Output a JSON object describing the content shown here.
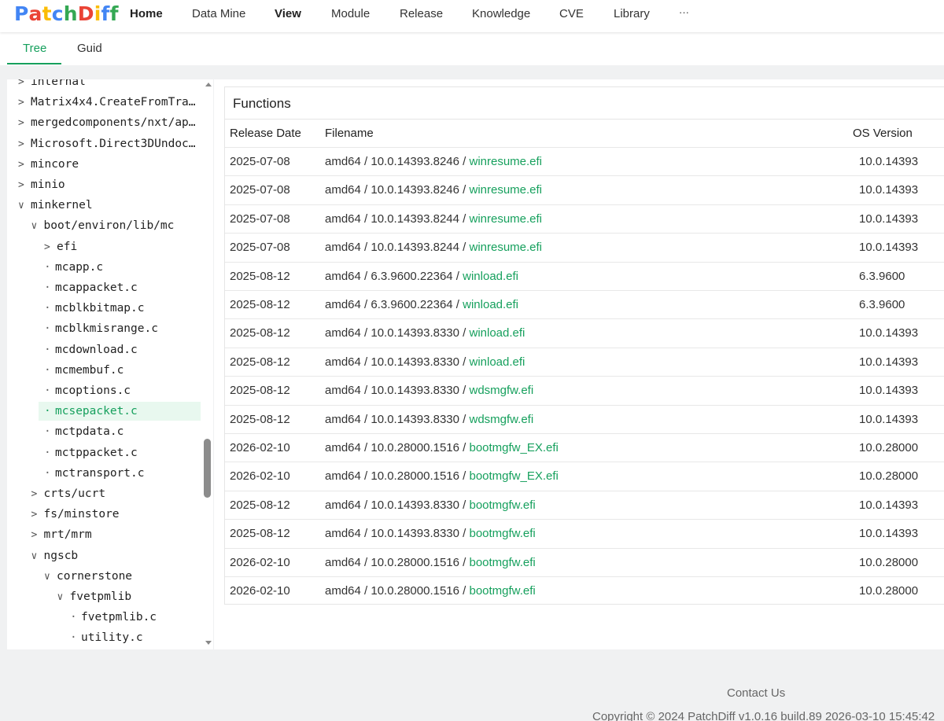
{
  "brand": {
    "letters": [
      {
        "char": "P",
        "color": "#4285F4"
      },
      {
        "char": "a",
        "color": "#EA4335"
      },
      {
        "char": "t",
        "color": "#FBBC05"
      },
      {
        "char": "c",
        "color": "#4285F4"
      },
      {
        "char": "h",
        "color": "#34A853"
      },
      {
        "char": "D",
        "color": "#EA4335"
      },
      {
        "char": "i",
        "color": "#FBBC05"
      },
      {
        "char": "f",
        "color": "#4285F4"
      },
      {
        "char": "f",
        "color": "#34A853"
      }
    ]
  },
  "nav": {
    "home": "Home",
    "data_mine": "Data Mine",
    "view": "View",
    "module": "Module",
    "release": "Release",
    "knowledge": "Knowledge",
    "cve": "CVE",
    "library": "Library",
    "more": "···"
  },
  "tabs": {
    "tree": "Tree",
    "guid": "Guid"
  },
  "accent_color": "#16a05d",
  "tree": [
    {
      "label": "internal",
      "type": "folder",
      "expanded": false,
      "depth": 0
    },
    {
      "label": "Matrix4x4.CreateFromTra…",
      "type": "folder",
      "expanded": false,
      "depth": 0
    },
    {
      "label": "mergedcomponents/nxt/ap…",
      "type": "folder",
      "expanded": false,
      "depth": 0
    },
    {
      "label": "Microsoft.Direct3DUndoc…",
      "type": "folder",
      "expanded": false,
      "depth": 0
    },
    {
      "label": "mincore",
      "type": "folder",
      "expanded": false,
      "depth": 0
    },
    {
      "label": "minio",
      "type": "folder",
      "expanded": false,
      "depth": 0
    },
    {
      "label": "minkernel",
      "type": "folder",
      "expanded": true,
      "depth": 0
    },
    {
      "label": "boot/environ/lib/mc",
      "type": "folder",
      "expanded": true,
      "depth": 1
    },
    {
      "label": "efi",
      "type": "folder",
      "expanded": false,
      "depth": 2
    },
    {
      "label": "mcapp.c",
      "type": "file",
      "depth": 2
    },
    {
      "label": "mcappacket.c",
      "type": "file",
      "depth": 2
    },
    {
      "label": "mcblkbitmap.c",
      "type": "file",
      "depth": 2
    },
    {
      "label": "mcblkmisrange.c",
      "type": "file",
      "depth": 2
    },
    {
      "label": "mcdownload.c",
      "type": "file",
      "depth": 2
    },
    {
      "label": "mcmembuf.c",
      "type": "file",
      "depth": 2
    },
    {
      "label": "mcoptions.c",
      "type": "file",
      "depth": 2
    },
    {
      "label": "mcsepacket.c",
      "type": "file",
      "depth": 2,
      "selected": true
    },
    {
      "label": "mctpdata.c",
      "type": "file",
      "depth": 2
    },
    {
      "label": "mctppacket.c",
      "type": "file",
      "depth": 2
    },
    {
      "label": "mctransport.c",
      "type": "file",
      "depth": 2
    },
    {
      "label": "crts/ucrt",
      "type": "folder",
      "expanded": false,
      "depth": 1
    },
    {
      "label": "fs/minstore",
      "type": "folder",
      "expanded": false,
      "depth": 1
    },
    {
      "label": "mrt/mrm",
      "type": "folder",
      "expanded": false,
      "depth": 1
    },
    {
      "label": "ngscb",
      "type": "folder",
      "expanded": true,
      "depth": 1
    },
    {
      "label": "cornerstone",
      "type": "folder",
      "expanded": true,
      "depth": 2
    },
    {
      "label": "fvetpmlib",
      "type": "folder",
      "expanded": true,
      "depth": 3
    },
    {
      "label": "fvetpmlib.c",
      "type": "file",
      "depth": 4
    },
    {
      "label": "utility.c",
      "type": "file",
      "depth": 4
    }
  ],
  "functions": {
    "title": "Functions",
    "columns": {
      "release_date": "Release Date",
      "filename": "Filename",
      "os_version": "OS Version"
    },
    "rows": [
      {
        "date": "2025-07-08",
        "path": "amd64 / 10.0.14393.8246 / ",
        "file": "winresume.efi",
        "os": "10.0.14393"
      },
      {
        "date": "2025-07-08",
        "path": "amd64 / 10.0.14393.8246 / ",
        "file": "winresume.efi",
        "os": "10.0.14393"
      },
      {
        "date": "2025-07-08",
        "path": "amd64 / 10.0.14393.8244 / ",
        "file": "winresume.efi",
        "os": "10.0.14393"
      },
      {
        "date": "2025-07-08",
        "path": "amd64 / 10.0.14393.8244 / ",
        "file": "winresume.efi",
        "os": "10.0.14393"
      },
      {
        "date": "2025-08-12",
        "path": "amd64 / 6.3.9600.22364 / ",
        "file": "winload.efi",
        "os": "6.3.9600"
      },
      {
        "date": "2025-08-12",
        "path": "amd64 / 6.3.9600.22364 / ",
        "file": "winload.efi",
        "os": "6.3.9600"
      },
      {
        "date": "2025-08-12",
        "path": "amd64 / 10.0.14393.8330 / ",
        "file": "winload.efi",
        "os": "10.0.14393"
      },
      {
        "date": "2025-08-12",
        "path": "amd64 / 10.0.14393.8330 / ",
        "file": "winload.efi",
        "os": "10.0.14393"
      },
      {
        "date": "2025-08-12",
        "path": "amd64 / 10.0.14393.8330 / ",
        "file": "wdsmgfw.efi",
        "os": "10.0.14393"
      },
      {
        "date": "2025-08-12",
        "path": "amd64 / 10.0.14393.8330 / ",
        "file": "wdsmgfw.efi",
        "os": "10.0.14393"
      },
      {
        "date": "2026-02-10",
        "path": "amd64 / 10.0.28000.1516 / ",
        "file": "bootmgfw_EX.efi",
        "os": "10.0.28000"
      },
      {
        "date": "2026-02-10",
        "path": "amd64 / 10.0.28000.1516 / ",
        "file": "bootmgfw_EX.efi",
        "os": "10.0.28000"
      },
      {
        "date": "2025-08-12",
        "path": "amd64 / 10.0.14393.8330 / ",
        "file": "bootmgfw.efi",
        "os": "10.0.14393"
      },
      {
        "date": "2025-08-12",
        "path": "amd64 / 10.0.14393.8330 / ",
        "file": "bootmgfw.efi",
        "os": "10.0.14393"
      },
      {
        "date": "2026-02-10",
        "path": "amd64 / 10.0.28000.1516 / ",
        "file": "bootmgfw.efi",
        "os": "10.0.28000"
      },
      {
        "date": "2026-02-10",
        "path": "amd64 / 10.0.28000.1516 / ",
        "file": "bootmgfw.efi",
        "os": "10.0.28000"
      }
    ]
  },
  "footer": {
    "contact": "Contact Us",
    "copyright": "Copyright © 2024 PatchDiff v1.0.16 build.89 2026-03-10 15:45:42"
  }
}
